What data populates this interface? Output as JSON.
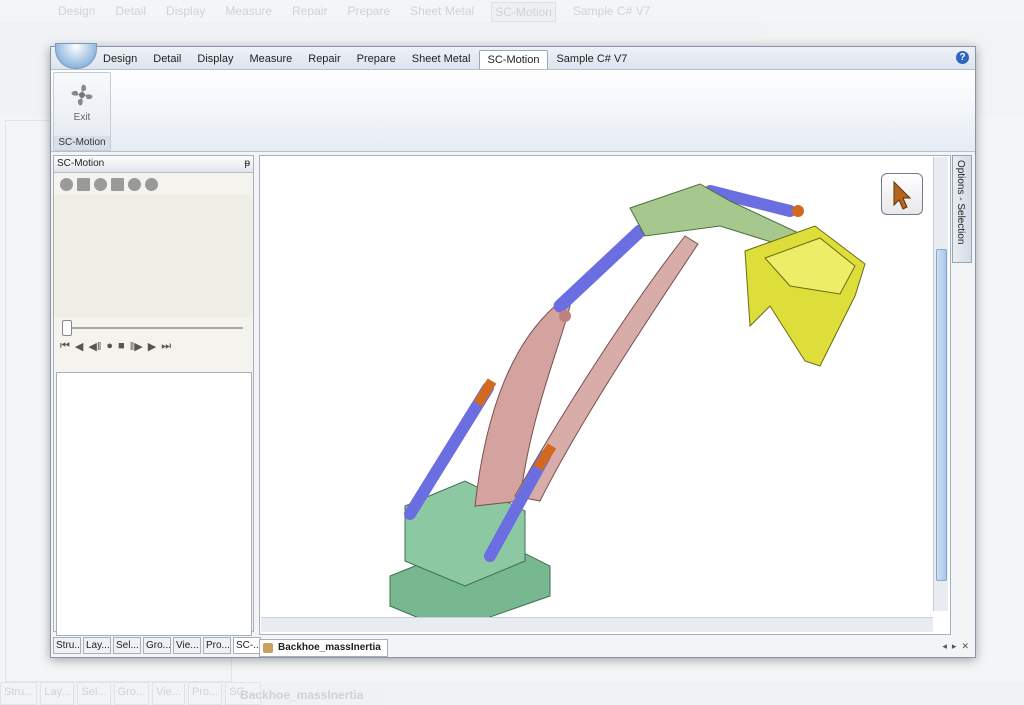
{
  "ghost": {
    "tabs": [
      "Design",
      "Detail",
      "Display",
      "Measure",
      "Repair",
      "Prepare",
      "Sheet Metal",
      "SC-Motion",
      "Sample C# V7"
    ],
    "bottom_tabs": [
      "Stru...",
      "Lay...",
      "Sel...",
      "Gro...",
      "Vie...",
      "Pro...",
      "SC-..."
    ],
    "doc_tab": "Backhoe_massInertia"
  },
  "ribbon": {
    "tabs": [
      "Design",
      "Detail",
      "Display",
      "Measure",
      "Repair",
      "Prepare",
      "Sheet Metal",
      "SC-Motion",
      "Sample C# V7"
    ],
    "active_tab": "SC-Motion",
    "help_label": "?",
    "exit_label": "Exit",
    "group_name": "SC-Motion"
  },
  "left_panel": {
    "title": "SC-Motion",
    "pin": "ᵽ",
    "player_controls": [
      "⏮",
      "◀",
      "◀‖",
      "●",
      "■",
      "‖▶",
      "▶",
      "⏭"
    ],
    "bottom_tabs": [
      "Stru...",
      "Lay...",
      "Sel...",
      "Gro...",
      "Vie...",
      "Pro...",
      "SC-..."
    ],
    "active_bottom_tab": "SC-..."
  },
  "viewport": {
    "options_label": "Options - Selection",
    "doc_tab": "Backhoe_massInertia",
    "nav_arrows": [
      "◂",
      "▸",
      "✕"
    ]
  },
  "colors": {
    "base": "#78b890",
    "boom": "#d4a3a0",
    "cylinder": "#6a6ee0",
    "cylinder_end": "#d2691e",
    "arm": "#a6c88e",
    "bucket": "#dede3a"
  }
}
